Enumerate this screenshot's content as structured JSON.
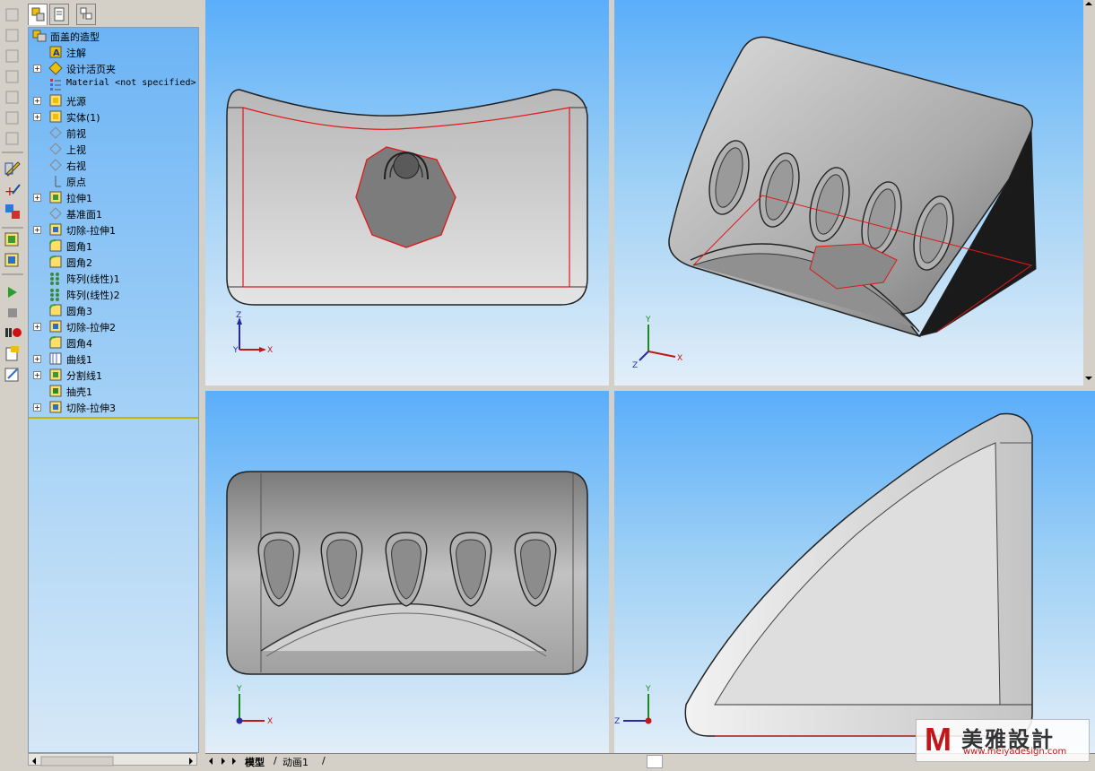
{
  "feature_tree": {
    "root": "面盖的造型",
    "items": [
      {
        "label": "注解",
        "icon": "annotation-icon",
        "expand": false
      },
      {
        "label": "设计活页夹",
        "icon": "design-binder-icon",
        "expand": true
      },
      {
        "label": "Material <not specified>",
        "icon": "material-icon",
        "expand": false,
        "mono": true
      },
      {
        "label": "光源",
        "icon": "lights-icon",
        "expand": true
      },
      {
        "label": "实体(1)",
        "icon": "solid-bodies-icon",
        "expand": true
      },
      {
        "label": "前视",
        "icon": "plane-icon",
        "expand": false
      },
      {
        "label": "上视",
        "icon": "plane-icon",
        "expand": false
      },
      {
        "label": "右视",
        "icon": "plane-icon",
        "expand": false
      },
      {
        "label": "原点",
        "icon": "origin-icon",
        "expand": false
      },
      {
        "label": "拉伸1",
        "icon": "extrude-icon",
        "expand": true
      },
      {
        "label": "基准面1",
        "icon": "plane-icon",
        "expand": false
      },
      {
        "label": "切除-拉伸1",
        "icon": "cut-extrude-icon",
        "expand": true
      },
      {
        "label": "圆角1",
        "icon": "fillet-icon",
        "expand": false
      },
      {
        "label": "圆角2",
        "icon": "fillet-icon",
        "expand": false
      },
      {
        "label": "阵列(线性)1",
        "icon": "linear-pattern-icon",
        "expand": false
      },
      {
        "label": "阵列(线性)2",
        "icon": "linear-pattern-icon",
        "expand": false
      },
      {
        "label": "圆角3",
        "icon": "fillet-icon",
        "expand": false
      },
      {
        "label": "切除-拉伸2",
        "icon": "cut-extrude-icon",
        "expand": true
      },
      {
        "label": "圆角4",
        "icon": "fillet-icon",
        "expand": false
      },
      {
        "label": "曲线1",
        "icon": "curve-icon",
        "expand": true
      },
      {
        "label": "分割线1",
        "icon": "split-line-icon",
        "expand": true
      },
      {
        "label": "抽壳1",
        "icon": "shell-icon",
        "expand": false
      },
      {
        "label": "切除-拉伸3",
        "icon": "cut-extrude-icon",
        "expand": true
      }
    ]
  },
  "tabs": {
    "model": "模型",
    "animation": "动画1"
  },
  "axes": {
    "x": "X",
    "y": "Y",
    "z": "Z"
  },
  "watermark": {
    "logo": "M",
    "text": "美雅設計",
    "url": "www.meiyadesign.com"
  },
  "colors": {
    "viewport_top": "#5aaefa",
    "viewport_bottom": "#e2eef8",
    "tree_top": "#6cb4f5",
    "red_edge": "#e01818"
  }
}
